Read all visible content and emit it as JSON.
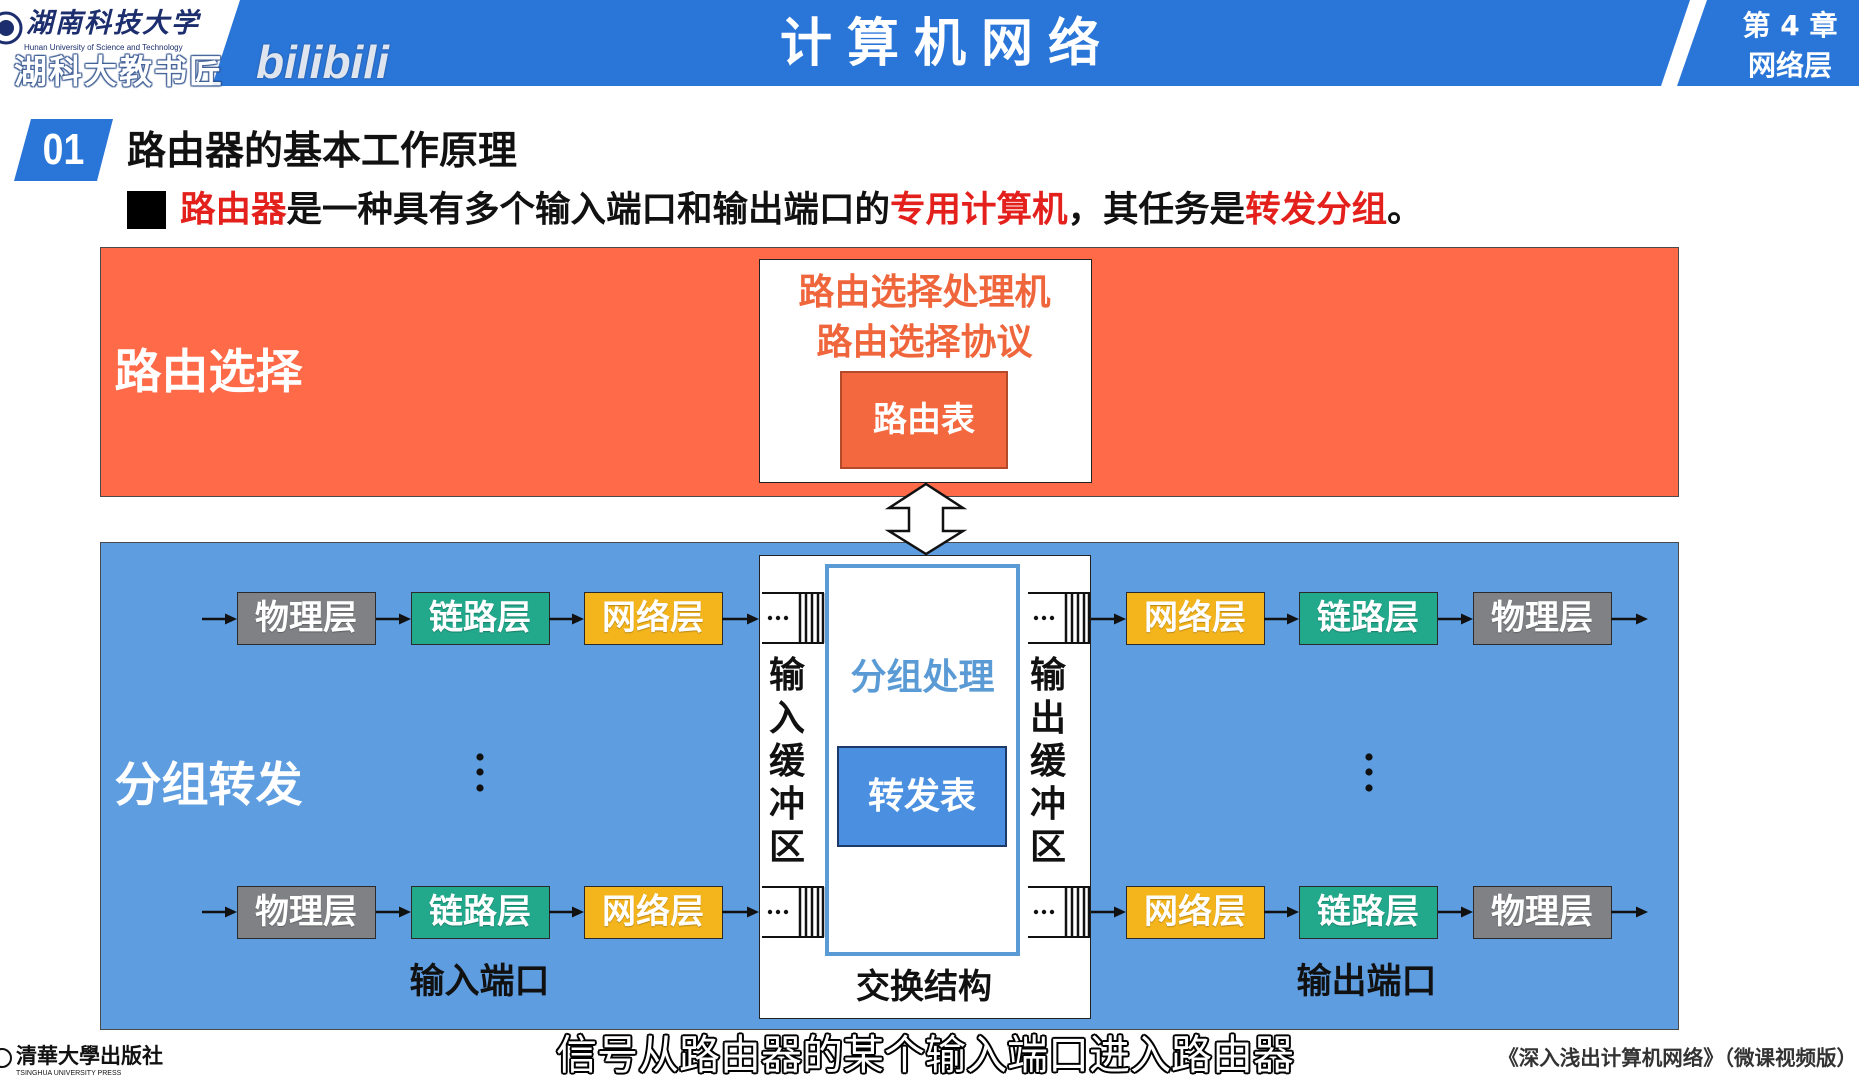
{
  "header": {
    "university_name": "湖南科技大学",
    "university_name_en": "Hunan University of Science and Technology",
    "watermark_channel": "湖科大教书匠",
    "watermark_site": "bilibili",
    "course_title": "计算机网络",
    "chapter": "第 4 章",
    "chapter_title": "网络层"
  },
  "section": {
    "number": "01",
    "title": "路由器的基本工作原理"
  },
  "bullet": {
    "segments": [
      "路由器",
      "是一种具有多个输入端口和输出端口的",
      "专用计算机",
      "，其任务是",
      "转发分组",
      "。"
    ]
  },
  "diagram": {
    "routing": {
      "label": "路由选择",
      "processor_line1": "路由选择处理机",
      "processor_line2": "路由选择协议",
      "routing_table": "路由表"
    },
    "forwarding": {
      "label": "分组转发",
      "input_ports": {
        "label": "输入端口",
        "rows": [
          [
            "物理层",
            "链路层",
            "网络层"
          ],
          [
            "物理层",
            "链路层",
            "网络层"
          ]
        ]
      },
      "input_buffer": "输入缓冲区",
      "switch_fabric": {
        "processing": "分组处理",
        "forwarding_table": "转发表",
        "label": "交换结构"
      },
      "output_buffer": "输出缓冲区",
      "output_ports": {
        "label": "输出端口",
        "rows": [
          [
            "网络层",
            "链路层",
            "物理层"
          ],
          [
            "网络层",
            "链路层",
            "物理层"
          ]
        ]
      }
    }
  },
  "subtitle": "信号从路由器的某个输入端口进入路由器",
  "footer": {
    "publisher": "清華大學出版社",
    "publisher_en": "TSINGHUA UNIVERSITY PRESS",
    "book_title": "《深入浅出计算机网络》（微课视频版）"
  },
  "colors": {
    "header_blue": "#2A76D8",
    "highlight_red": "#E3201B",
    "routing_plane": "#FF6A48",
    "routing_text": "#F0663C",
    "routing_table": "#F4683F",
    "forwarding_plane": "#5E9DE0",
    "forwarding_table": "#4A8FE0",
    "processing_text": "#5B9BD5",
    "physical_layer": "#7F8185",
    "link_layer": "#22A98C",
    "network_layer": "#F4B41C"
  }
}
